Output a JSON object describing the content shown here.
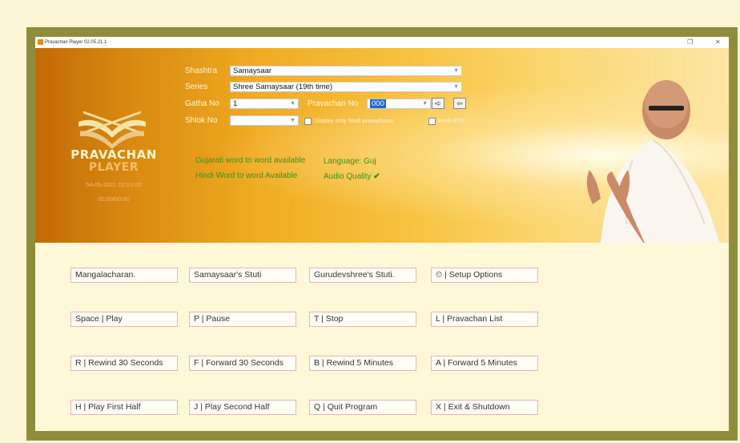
{
  "window": {
    "title": "Pravachan Player 02.05.21.1",
    "restore_glyph": "❐",
    "close_glyph": "✕"
  },
  "logo": {
    "line1": "PRAVACHAN",
    "line2": "PLAYER",
    "datetime": "04-05-2021 02:03:00",
    "timer": "00:00/00:00"
  },
  "form": {
    "shashtra_label": "Shashtra",
    "shashtra_value": "Samaysaar",
    "series_label": "Series",
    "series_value": "Shree Samaysaar (19th time)",
    "gatha_label": "Gatha No",
    "gatha_value": "1",
    "pravachan_label": "Pravachan No",
    "pravachan_value": "000",
    "shlok_label": "Shlok No",
    "shlok_value": "",
    "next_glyph": "➪",
    "prev_glyph": "⇦",
    "hindi_only_label": "Display only hindi pravachans",
    "hindi_pdf_label": "Hindi PDF"
  },
  "info": {
    "gujarati_word": "Gujarati word to word available",
    "language": "Language: Guj",
    "hindi_word": "Hindi Word to word Available",
    "audio_quality": "Audio Quality",
    "check": "✔"
  },
  "buttons": [
    [
      "Mangalacharan.",
      "Samaysaar's Stuti",
      "Gurudevshree's Stuti.",
      "⏲ | Setup Options"
    ],
    [
      "Space | Play",
      "P | Pause",
      "T | Stop",
      "L | Pravachan List"
    ],
    [
      "R | Rewind 30 Seconds",
      "F | Forward 30 Seconds",
      "B | Rewind 5 Minutes",
      "A | Forward 5 Minutes"
    ],
    [
      "H | Play First Half",
      "J | Play Second Half",
      "Q | Quit Program",
      "X | Exit & Shutdown"
    ]
  ],
  "colors": {
    "frame": "#8f8d3c",
    "accent_green": "#3a9417",
    "highlight": "#1f66d1"
  }
}
